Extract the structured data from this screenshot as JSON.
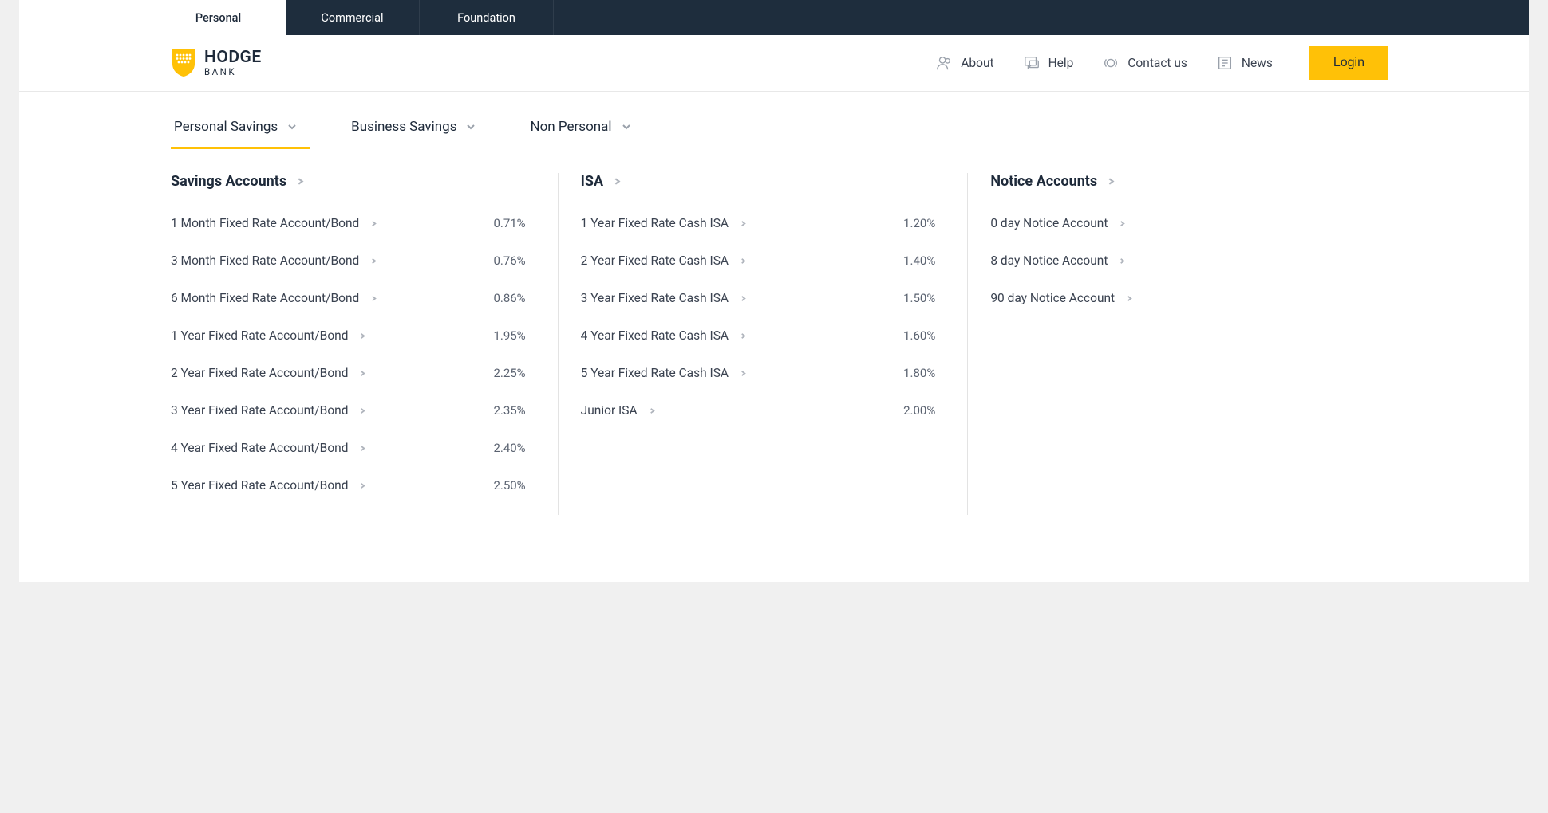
{
  "top_tabs": [
    "Personal",
    "Commercial",
    "Foundation"
  ],
  "logo": {
    "name": "HODGE",
    "sub": "BANK"
  },
  "header_nav": [
    "About",
    "Help",
    "Contact us",
    "News"
  ],
  "login_label": "Login",
  "sub_tabs": [
    "Personal Savings",
    "Business Savings",
    "Non Personal"
  ],
  "columns": [
    {
      "title": "Savings Accounts",
      "items": [
        {
          "name": "1 Month Fixed Rate Account/Bond",
          "rate": "0.71%"
        },
        {
          "name": "3 Month Fixed Rate Account/Bond",
          "rate": "0.76%"
        },
        {
          "name": "6 Month Fixed Rate Account/Bond",
          "rate": "0.86%"
        },
        {
          "name": "1 Year Fixed Rate Account/Bond",
          "rate": "1.95%"
        },
        {
          "name": "2 Year Fixed Rate Account/Bond",
          "rate": "2.25%"
        },
        {
          "name": "3 Year Fixed Rate Account/Bond",
          "rate": "2.35%"
        },
        {
          "name": "4 Year Fixed Rate Account/Bond",
          "rate": "2.40%"
        },
        {
          "name": "5 Year Fixed Rate Account/Bond",
          "rate": "2.50%"
        }
      ]
    },
    {
      "title": "ISA",
      "items": [
        {
          "name": "1 Year Fixed Rate Cash ISA",
          "rate": "1.20%"
        },
        {
          "name": "2 Year Fixed Rate Cash ISA",
          "rate": "1.40%"
        },
        {
          "name": "3 Year Fixed Rate Cash ISA",
          "rate": "1.50%"
        },
        {
          "name": "4 Year Fixed Rate Cash ISA",
          "rate": "1.60%"
        },
        {
          "name": "5 Year Fixed Rate Cash ISA",
          "rate": "1.80%"
        },
        {
          "name": "Junior ISA",
          "rate": "2.00%"
        }
      ]
    },
    {
      "title": "Notice Accounts",
      "items": [
        {
          "name": "0 day Notice Account",
          "rate": ""
        },
        {
          "name": "8 day Notice Account",
          "rate": ""
        },
        {
          "name": "90 day Notice Account",
          "rate": ""
        }
      ]
    }
  ]
}
